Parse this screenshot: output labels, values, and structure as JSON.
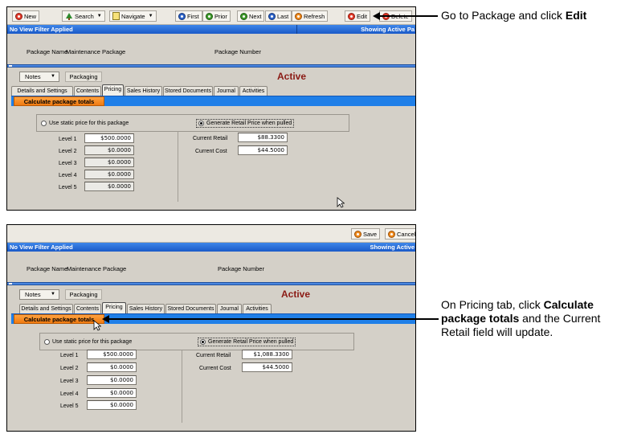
{
  "callouts": {
    "first": {
      "text": "Go to Package and click ",
      "bold": "Edit"
    },
    "second": {
      "line1": "On Pricing tab, click ",
      "bold1": "Calculate",
      "bold2": "package totals",
      "rest2": " and the Current",
      "line3": "Retail field will update."
    }
  },
  "shot1": {
    "toolbar": {
      "new": "New",
      "search": "Search",
      "navigate": "Navigate",
      "first": "First",
      "prior": "Prior",
      "next": "Next",
      "last": "Last",
      "refresh": "Refresh",
      "edit": "Edit",
      "delete": "Delete"
    },
    "filter_text": "No View Filter Applied",
    "showing_text": "Showing Active Pa",
    "package_name_label": "Package Name",
    "package_name_value": "Maintenance Package",
    "package_number_label": "Package Number",
    "notes_label": "Notes",
    "packaging_label": "Packaging",
    "status": "Active",
    "tabs": [
      "Details and Settings",
      "Contents",
      "Pricing",
      "Sales History",
      "Stored Documents",
      "Journal",
      "Activities"
    ],
    "calc_label": "Calculate package totals",
    "static_price_label": "Use static price for this package",
    "generate_label": "Generate Retail Price when pulled",
    "levels": [
      {
        "label": "Level 1",
        "value": "$500.0000"
      },
      {
        "label": "Level 2",
        "value": "$0.0000"
      },
      {
        "label": "Level 3",
        "value": "$0.0000"
      },
      {
        "label": "Level 4",
        "value": "$0.0000"
      },
      {
        "label": "Level 5",
        "value": "$0.0000"
      }
    ],
    "current_retail_label": "Current Retail",
    "current_retail_value": "$88.3300",
    "current_cost_label": "Current Cost",
    "current_cost_value": "$44.5000"
  },
  "shot2": {
    "toolbar": {
      "save": "Save",
      "cancel": "Cancel"
    },
    "filter_text": "No View Filter Applied",
    "showing_text": "Showing Active",
    "package_name_label": "Package Name",
    "package_name_value": "Maintenance Package",
    "package_number_label": "Package Number",
    "notes_label": "Notes",
    "packaging_label": "Packaging",
    "status": "Active",
    "tabs": [
      "Details and Settings",
      "Contents",
      "Pricing",
      "Sales History",
      "Stored Documents",
      "Journal",
      "Activities"
    ],
    "calc_label": "Calculate package totals",
    "static_price_label": "Use static price for this package",
    "generate_label": "Generate Retail Price when pulled",
    "levels": [
      {
        "label": "Level 1",
        "value": "$500.0000"
      },
      {
        "label": "Level 2",
        "value": "$0.0000"
      },
      {
        "label": "Level 3",
        "value": "$0.0000"
      },
      {
        "label": "Level 4",
        "value": "$0.0000"
      },
      {
        "label": "Level 5",
        "value": "$0.0000"
      }
    ],
    "current_retail_label": "Current Retail",
    "current_retail_value": "$1,088.3300",
    "current_cost_label": "Current Cost",
    "current_cost_value": "$44.5000"
  },
  "colors": {
    "filter_bar": "#1a5ac8",
    "calc_bar": "#1f7fe8",
    "calc_button": "#f07a10",
    "status_text": "#8b1a14"
  }
}
